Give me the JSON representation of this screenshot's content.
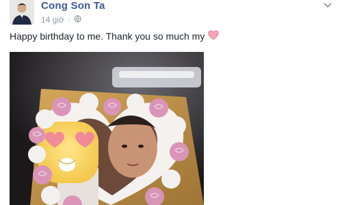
{
  "post": {
    "author_name": "Cong Son Ta",
    "timestamp": "14 giờ",
    "audience_icon": "globe-icon",
    "status_text": "Happy birthday to me. Thank you so much my",
    "status_emoji": "heart-icon",
    "menu_icon": "chevron-down-icon"
  },
  "colors": {
    "link": "#3b5998",
    "meta": "#90949c",
    "text": "#1d2129",
    "heart": "#f4a7b9",
    "cake_pink": "#d994b8",
    "cake_white": "#f3f1ef"
  }
}
